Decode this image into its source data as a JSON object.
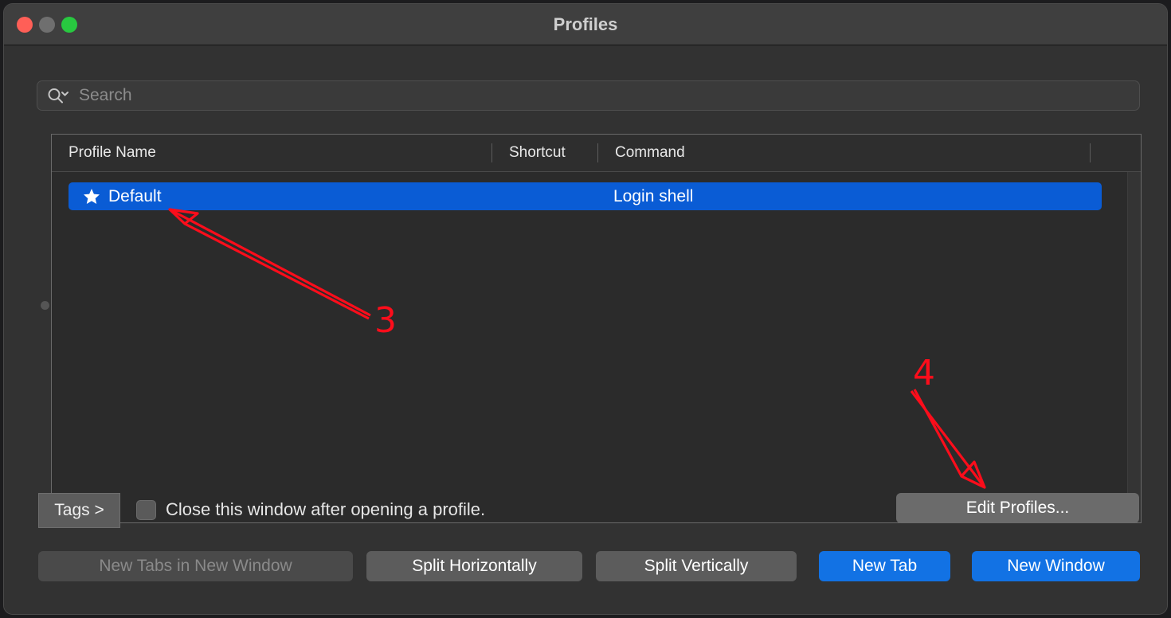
{
  "window": {
    "title": "Profiles",
    "traffic_lights": [
      {
        "name": "close",
        "color": "#ff5f57"
      },
      {
        "name": "minimize",
        "color": "#6f6f6f"
      },
      {
        "name": "maximize",
        "color": "#28c840"
      }
    ]
  },
  "search": {
    "placeholder": "Search",
    "value": "",
    "icon": "search-icon",
    "dropdown_icon": "chevron-down-icon"
  },
  "table": {
    "columns": [
      {
        "key": "name",
        "label": "Profile Name"
      },
      {
        "key": "shortcut",
        "label": "Shortcut"
      },
      {
        "key": "command",
        "label": "Command"
      }
    ],
    "rows": [
      {
        "name": "Default",
        "shortcut": "",
        "command": "Login shell",
        "is_default": true,
        "selected": true,
        "icon": "star-icon"
      }
    ]
  },
  "options": {
    "tags_button": "Tags >",
    "close_window_checkbox": {
      "label": "Close this window after opening a profile.",
      "checked": false
    },
    "edit_profiles_button": "Edit Profiles..."
  },
  "actions": [
    {
      "key": "new_tabs_in_new_window",
      "label": "New Tabs in New Window",
      "style": "disabled"
    },
    {
      "key": "split_horizontally",
      "label": "Split Horizontally",
      "style": "gray"
    },
    {
      "key": "split_vertically",
      "label": "Split Vertically",
      "style": "gray"
    },
    {
      "key": "new_tab",
      "label": "New Tab",
      "style": "blue"
    },
    {
      "key": "new_window",
      "label": "New Window",
      "style": "blue"
    }
  ],
  "annotations": {
    "color": "#fc0d1b",
    "marks": [
      {
        "label": "3",
        "points_to": "default-profile-row"
      },
      {
        "label": "4",
        "points_to": "edit-profiles-button"
      }
    ]
  },
  "colors": {
    "titlebar": "#3f3f3f",
    "body": "#323232",
    "selection_blue": "#0a5cd5",
    "accent_blue": "#1272e4",
    "annotation_red": "#fc0d1b"
  }
}
